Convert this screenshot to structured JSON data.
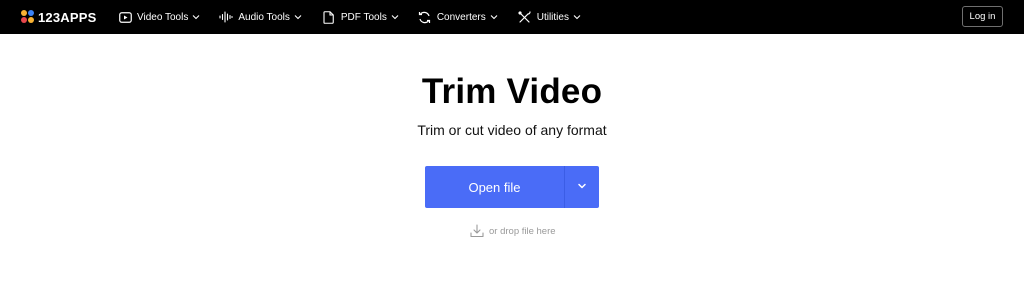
{
  "brand": {
    "name": "123APPS",
    "dot_colors": [
      "#f9b233",
      "#3b82f6",
      "#e8474c",
      "#f9b233"
    ]
  },
  "nav": {
    "items": [
      {
        "label": "Video Tools",
        "icon": "video-icon"
      },
      {
        "label": "Audio Tools",
        "icon": "audio-icon"
      },
      {
        "label": "PDF Tools",
        "icon": "pdf-icon"
      },
      {
        "label": "Converters",
        "icon": "converter-icon"
      },
      {
        "label": "Utilities",
        "icon": "utilities-icon"
      }
    ],
    "login_label": "Log in"
  },
  "main": {
    "title": "Trim Video",
    "subtitle": "Trim or cut video of any format",
    "open_file_label": "Open file",
    "drop_hint": "or drop file here"
  },
  "colors": {
    "navbar": "#000000",
    "accent": "#4a6cf7"
  }
}
